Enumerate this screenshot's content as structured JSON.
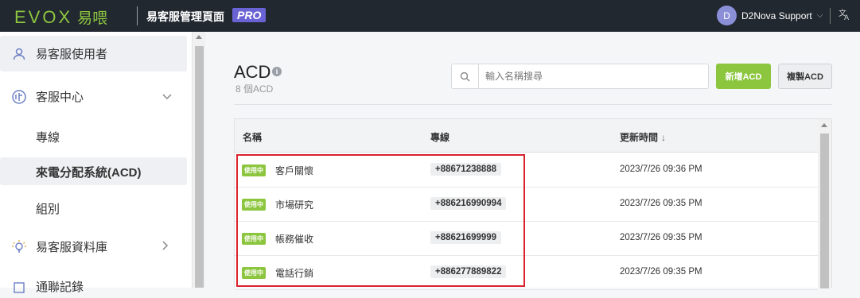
{
  "topbar": {
    "logo_text": "EVOX",
    "logo_cn": "易喂",
    "app_title": "易客服管理頁面",
    "pro_label": "PRO",
    "user_initial": "D",
    "user_name": "D2Nova Support",
    "lang_icon": "translate-icon"
  },
  "sidebar": {
    "items": [
      {
        "label": "易客服使用者",
        "icon": "user-icon"
      },
      {
        "label": "客服中心",
        "icon": "call-center-icon"
      },
      {
        "label": "專線"
      },
      {
        "label": "來電分配系統(ACD)"
      },
      {
        "label": "組別"
      },
      {
        "label": "易客服資料庫",
        "icon": "lightbulb-icon"
      },
      {
        "label": "通聯記錄",
        "icon": "record-icon"
      }
    ]
  },
  "main": {
    "title": "ACD",
    "count": "8 個ACD",
    "search_placeholder": "輸入名稱搜尋",
    "new_button": "新增ACD",
    "copy_button": "複製ACD"
  },
  "table": {
    "columns": [
      "名稱",
      "專線",
      "更新時間"
    ],
    "rows": [
      {
        "status": "使用中",
        "name": "客戶關懷",
        "phone": "+88671238888",
        "updated": "2023/7/26 09:36 PM"
      },
      {
        "status": "使用中",
        "name": "市場研究",
        "phone": "+886216990994",
        "updated": "2023/7/26 09:35 PM"
      },
      {
        "status": "使用中",
        "name": "帳務催收",
        "phone": "+88621699999",
        "updated": "2023/7/26 09:35 PM"
      },
      {
        "status": "使用中",
        "name": "電話行銷",
        "phone": "+886277889822",
        "updated": "2023/7/26 09:35 PM"
      }
    ]
  },
  "colors": {
    "brand_green": "#8cc63f",
    "pro_purple": "#6a63d6",
    "highlight_red": "#d9232e"
  }
}
